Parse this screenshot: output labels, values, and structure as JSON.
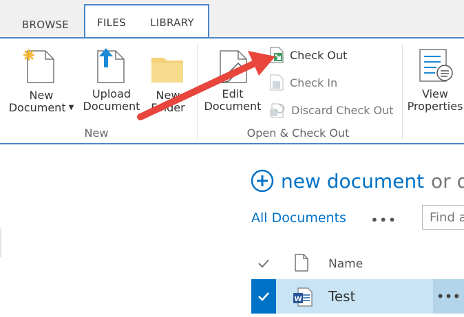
{
  "tabs": [
    {
      "label": "BROWSE"
    },
    {
      "label": "FILES"
    },
    {
      "label": "LIBRARY"
    }
  ],
  "ribbon": {
    "new_group": {
      "label": "New",
      "new_document_line1": "New",
      "new_document_line2": "Document",
      "upload_line1": "Upload",
      "upload_line2": "Document",
      "new_folder_line1": "New",
      "new_folder_line2": "Folder"
    },
    "checkout_group": {
      "label": "Open & Check Out",
      "edit_line1": "Edit",
      "edit_line2": "Document",
      "check_out": "Check Out",
      "check_in": "Check In",
      "discard_check_out": "Discard Check Out"
    },
    "view_props_line1": "View",
    "view_props_line2": "Properties"
  },
  "content": {
    "new_document_link": "new document",
    "or_text": "or d",
    "view_name": "All Documents",
    "more": "•••",
    "find_placeholder": "Find a",
    "column_name": "Name",
    "rows": [
      {
        "title": "Test",
        "more": "•••"
      }
    ]
  },
  "colors": {
    "accent": "#0072c6",
    "tab_border": "#4a86c8",
    "selected_row": "#c9e4f4",
    "arrow": "#e8453c"
  }
}
